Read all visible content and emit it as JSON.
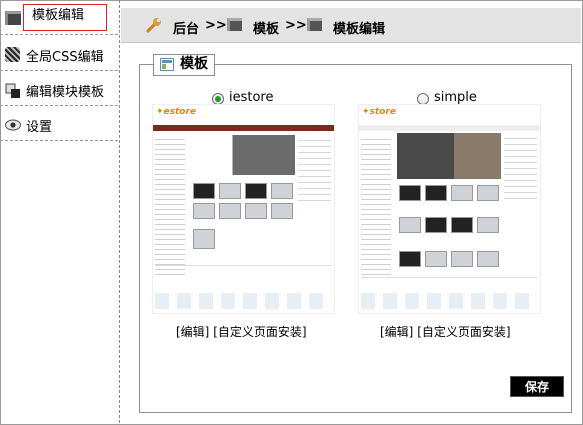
{
  "sidebar": {
    "items": [
      {
        "label": "模板编辑",
        "icon": "template-icon",
        "active": true
      },
      {
        "label": "全局CSS编辑",
        "icon": "css-icon"
      },
      {
        "label": "编辑模块模板",
        "icon": "module-icon"
      },
      {
        "label": "设置",
        "icon": "eye-icon"
      }
    ]
  },
  "breadcrumb": {
    "items": [
      "后台",
      "模板",
      "模板编辑"
    ],
    "separator": ">>",
    "icon": "wrench-icon"
  },
  "panel": {
    "legend": "模板",
    "templates": [
      {
        "name": "iestore",
        "selected": true,
        "edit_label": "[编辑]",
        "install_label": "[自定义页面安装]"
      },
      {
        "name": "simple",
        "selected": false,
        "edit_label": "[编辑]",
        "install_label": "[自定义页面安装]"
      }
    ],
    "save_label": "保存"
  },
  "colors": {
    "active_border": "#dd2222",
    "topbar": "#e3e3e3",
    "radio_on": "#2a9a2a"
  }
}
